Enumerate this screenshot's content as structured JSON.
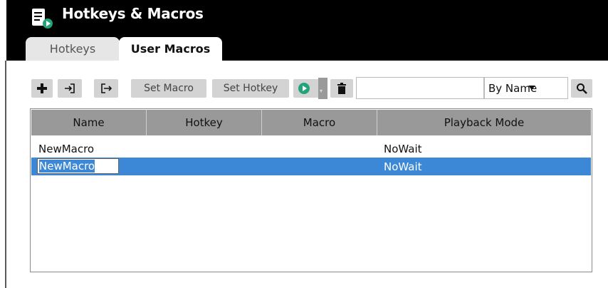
{
  "window": {
    "title": "Hotkeys & Macros",
    "app_icon": "document-play-icon"
  },
  "tabs": [
    {
      "label": "Hotkeys",
      "active": false
    },
    {
      "label": "User Macros",
      "active": true
    }
  ],
  "toolbar": {
    "add_icon": "plus-icon",
    "import_icon": "import-icon",
    "export_icon": "export-icon",
    "set_macro_label": "Set Macro",
    "set_hotkey_label": "Set Hotkey",
    "play_icon": "play-circle-icon",
    "delete_icon": "trash-icon",
    "search_value": "",
    "sort_selected": "By Name",
    "search_icon": "search-icon"
  },
  "table": {
    "columns": [
      "Name",
      "Hotkey",
      "Macro",
      "Playback Mode"
    ],
    "rows": [
      {
        "name": "NewMacro",
        "hotkey": "",
        "macro": "",
        "playback_mode": "NoWait",
        "selected": false
      },
      {
        "name": "NewMacro",
        "hotkey": "",
        "macro": "",
        "playback_mode": "NoWait",
        "selected": true,
        "editing": true
      }
    ]
  },
  "colors": {
    "header_bg": "#000000",
    "selection": "#3d88d6",
    "play_green": "#22a37a",
    "column_header_bg": "#999999"
  }
}
